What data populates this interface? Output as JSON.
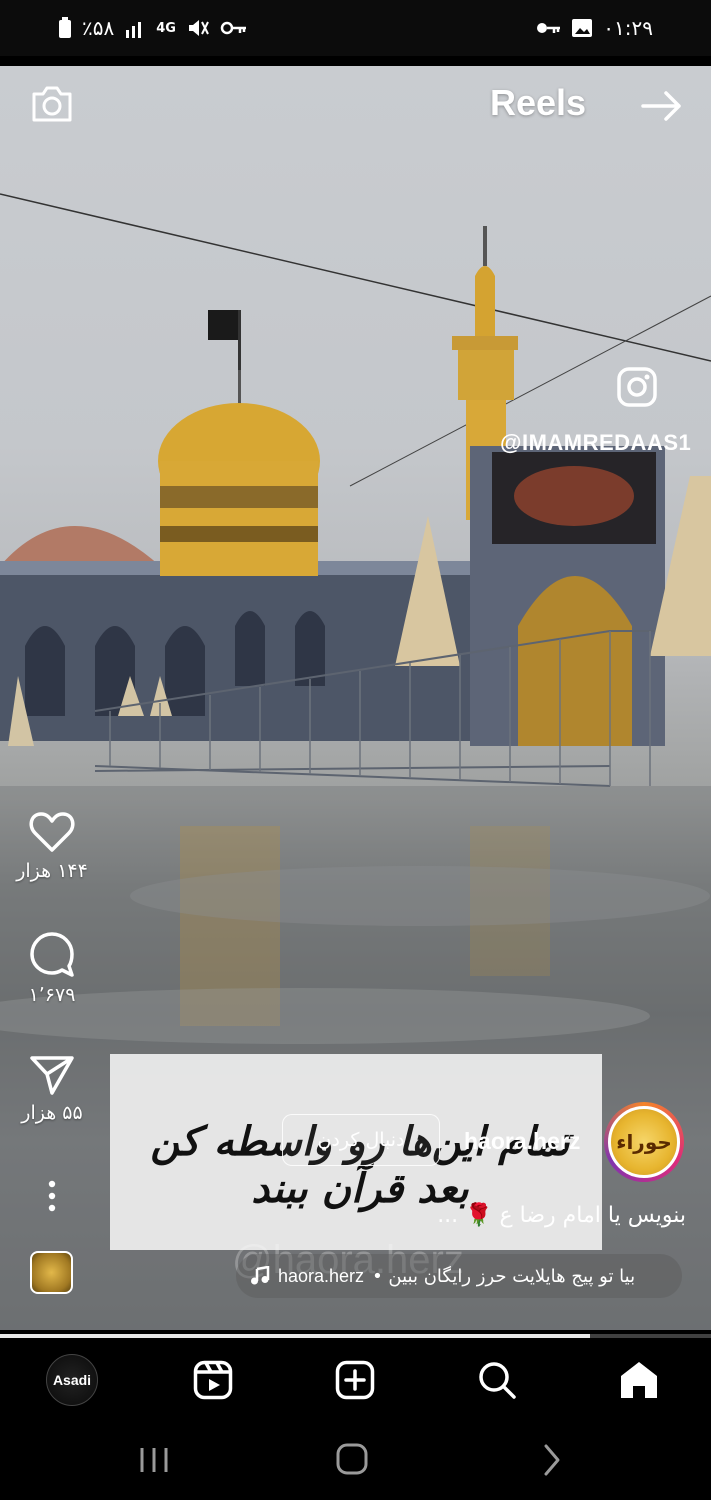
{
  "status_bar": {
    "battery": "٪۵۸",
    "signal": "4G",
    "time": "۰۱:۲۹"
  },
  "header": {
    "title": "Reels",
    "camera_icon": "camera-icon",
    "forward_icon": "arrow-right-icon"
  },
  "watermark": {
    "handle": "@IMAMREDAAS1",
    "bottom_handle": "@haora.herz"
  },
  "actions": {
    "likes": "۱۴۴ هزار",
    "comments": "۱٬۶۷۹",
    "shares": "۵۵ هزار"
  },
  "post": {
    "caption_overlay": "تمام این‌ها رو واسطه کن بعد قرآن ببند",
    "username": "haora.herz",
    "follow_label": "دنبال کردن",
    "avatar_text": "حوراء",
    "description": "بنویس یا امام رضا ع 🌹 ...",
    "audio_user": "haora.herz",
    "audio_text": "بیا تو پیج هایلایت حرز رایگان ببین •",
    "progress": 0.83
  },
  "bottom_nav": {
    "profile_label": "Asadi",
    "items": [
      "profile",
      "reels",
      "create",
      "search",
      "home"
    ]
  },
  "colors": {
    "background": "#000000",
    "avatar_ring": "#dd2a7b",
    "text": "#ffffff"
  }
}
